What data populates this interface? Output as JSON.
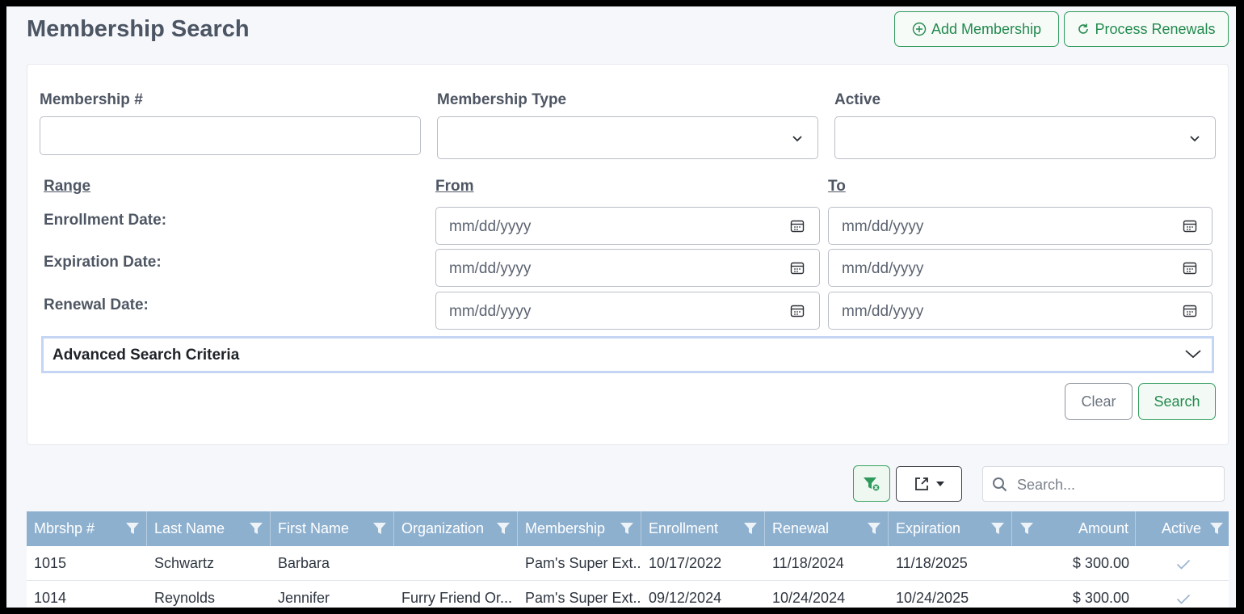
{
  "header": {
    "title": "Membership Search",
    "add_button": "Add Membership",
    "renew_button": "Process Renewals"
  },
  "filters": {
    "membership_number_label": "Membership #",
    "membership_type_label": "Membership Type",
    "active_label": "Active",
    "range_label": "Range",
    "from_label": "From",
    "to_label": "To",
    "enrollment_label": "Enrollment Date:",
    "expiration_label": "Expiration Date:",
    "renewal_label": "Renewal Date:",
    "date_placeholder": "mm/dd/yyyy",
    "advanced_label": "Advanced Search Criteria",
    "clear_button": "Clear",
    "search_button": "Search"
  },
  "grid": {
    "search_placeholder": "Search...",
    "columns": [
      "Mbrshp #",
      "Last Name",
      "First Name",
      "Organization",
      "Membership",
      "Enrollment",
      "Renewal",
      "Expiration",
      "",
      "Amount",
      "Active"
    ],
    "rows": [
      [
        "1015",
        "Schwartz",
        "Barbara",
        "",
        "Pam's Super Ext...",
        "10/17/2022",
        "11/18/2024",
        "11/18/2025",
        "",
        "$ 300.00"
      ],
      [
        "1014",
        "Reynolds",
        "Jennifer",
        "Furry Friend Or...",
        "Pam's Super Ext...",
        "09/12/2024",
        "10/24/2024",
        "10/24/2025",
        "",
        "$ 300.00"
      ]
    ]
  },
  "colors": {
    "accent_green": "#2e9a5c",
    "header_blue": "#8eb0cf"
  },
  "icons": {
    "add": "plus-circle-icon",
    "renew": "refresh-icon",
    "calendar": "calendar-icon",
    "filter": "funnel-icon",
    "export": "export-icon",
    "search": "search-icon",
    "active": "check-icon"
  }
}
